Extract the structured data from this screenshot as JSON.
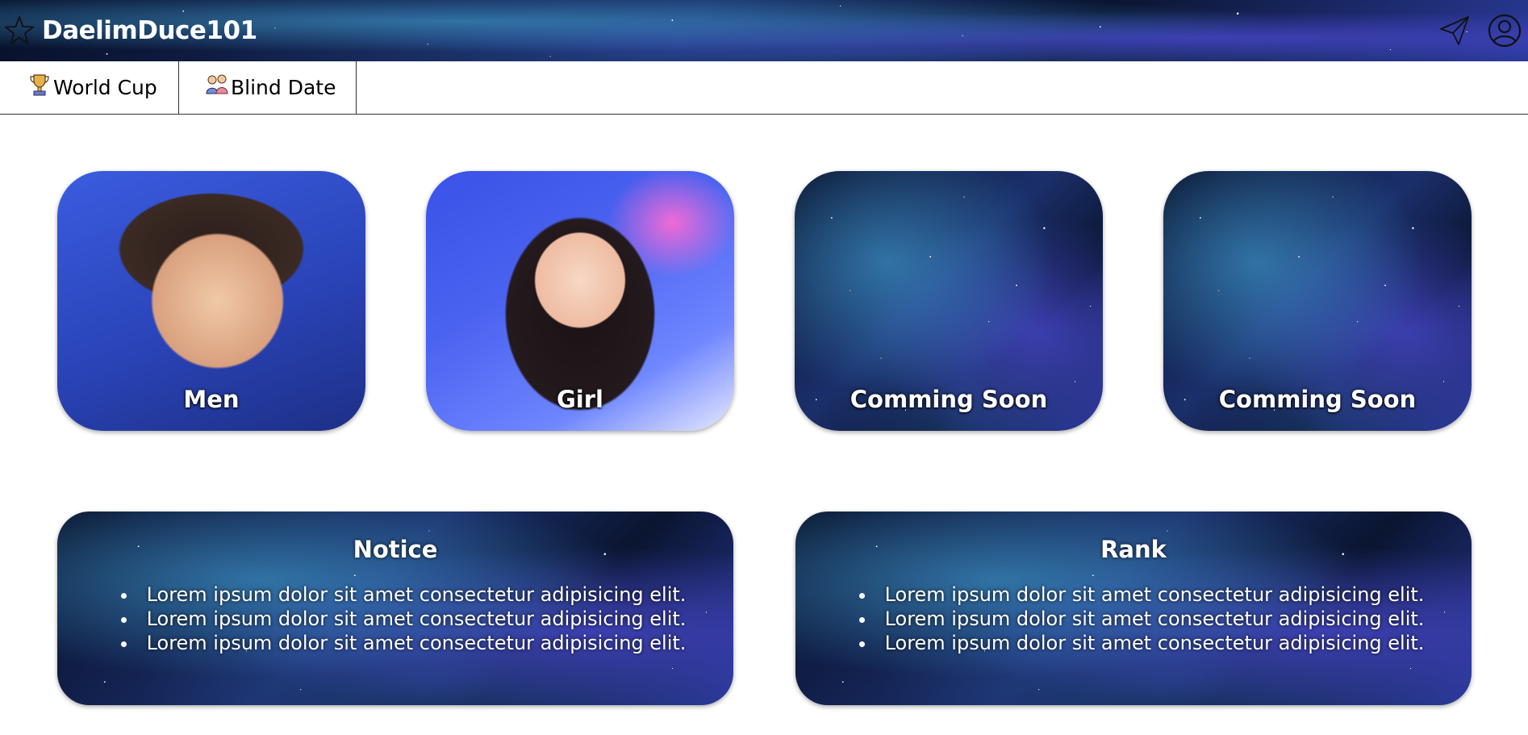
{
  "header": {
    "brand_title": "DaelimDuce101",
    "logo_icon": "star-outline-icon",
    "actions": [
      {
        "icon": "paper-plane-icon"
      },
      {
        "icon": "user-circle-icon"
      }
    ]
  },
  "nav": {
    "tabs": [
      {
        "label": "World Cup",
        "icon": "trophy-icon"
      },
      {
        "label": "Blind Date",
        "icon": "couple-icon"
      }
    ]
  },
  "cards": [
    {
      "label": "Men",
      "image": "photo-man"
    },
    {
      "label": "Girl",
      "image": "photo-woman"
    },
    {
      "label": "Comming Soon",
      "image": "galaxy"
    },
    {
      "label": "Comming Soon",
      "image": "galaxy"
    }
  ],
  "notice": {
    "title": "Notice",
    "items": [
      "Lorem ipsum dolor sit amet consectetur adipisicing elit.",
      "Lorem ipsum dolor sit amet consectetur adipisicing elit.",
      "Lorem ipsum dolor sit amet consectetur adipisicing elit."
    ]
  },
  "rank": {
    "title": "Rank",
    "items": [
      "Lorem ipsum dolor sit amet consectetur adipisicing elit.",
      "Lorem ipsum dolor sit amet consectetur adipisicing elit.",
      "Lorem ipsum dolor sit amet consectetur adipisicing elit."
    ]
  },
  "colors": {
    "header_bg": "#0b1330",
    "text_on_dark": "#ffffff",
    "nav_border": "#333333"
  }
}
